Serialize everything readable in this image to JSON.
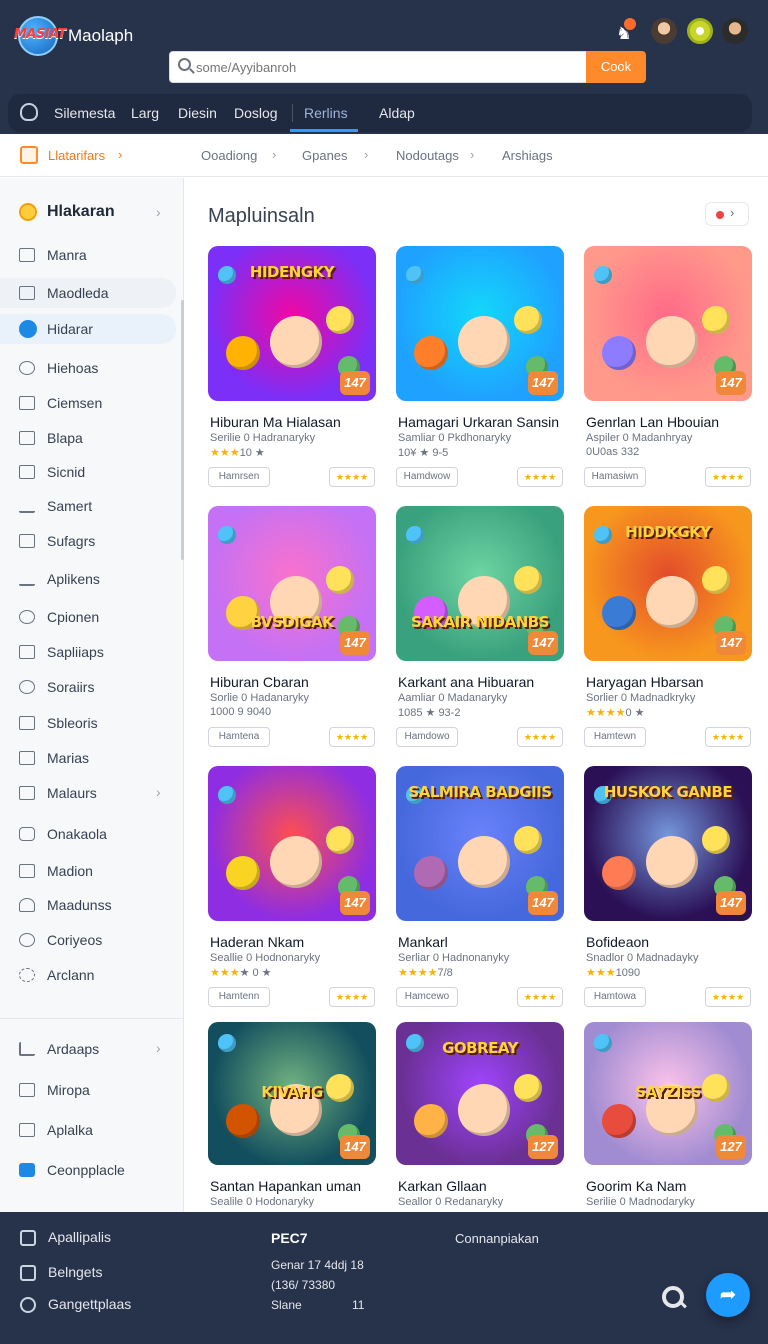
{
  "header": {
    "logo_text": "MASIAT",
    "app_title": "Maolaph",
    "search_placeholder": "some/Ayyibanroh",
    "search_button": "Cook"
  },
  "nav": {
    "items": [
      "Silemesta",
      "Larg",
      "Diesin",
      "Doslog",
      "Rerlins",
      "Aldap"
    ],
    "active_index": 4
  },
  "breadcrumb": {
    "items": [
      "Llatarifars",
      "Ooadiong",
      "Gpanes",
      "Nodoutags",
      "Arshiags"
    ]
  },
  "sidebar": {
    "header": "Hlakaran",
    "items": [
      "Manra",
      "Maodleda",
      "Hidarar",
      "Hiehoas",
      "Ciemsen",
      "Blapa",
      "Sicnid",
      "Samert",
      "Sufagrs",
      "Aplikens",
      "Cpionen",
      "Sapliiaps",
      "Soraiirs",
      "Sbleoris",
      "Marias",
      "Malaurs",
      "Onakaola",
      "Madion",
      "Maadunss",
      "Coriyeos",
      "Arclann"
    ],
    "bottom_items": [
      "Ardaaps",
      "Miropa",
      "Aplalka",
      "Ceonpplacle"
    ]
  },
  "main": {
    "section_title": "Mapluinsaln",
    "games": [
      {
        "thumb_title": "HIDENGKY",
        "title": "Hiburan Ma Hialasan",
        "sub": "Serilie 0 Hadranaryky",
        "stars": "★★★",
        "rating": "10 ★",
        "tag": "Hamrsen",
        "badge": "147"
      },
      {
        "thumb_title": "",
        "title": "Hamagari Urkaran Sansin",
        "sub": "Samliar 0 Pkdhonaryky",
        "stars": "",
        "rating": "10¥ ★ 9-5",
        "tag": "Hamdwow",
        "badge": "147"
      },
      {
        "thumb_title": "",
        "title": "Genrlan Lan Hbouian",
        "sub": "Aspiler 0 Madanhryay",
        "stars": "",
        "rating": "0U0as 332",
        "tag": "Hamasiwn",
        "badge": "147"
      },
      {
        "thumb_title": "BVSDIGAK",
        "title": "Hiburan Cbaran",
        "sub": "Sorlie 0 Hadanaryky",
        "stars": "",
        "rating": "1000 9 9040",
        "tag": "Hamtena",
        "badge": "147"
      },
      {
        "thumb_title": "SAKAIR NIDANBS",
        "title": "Karkant ana Hibuaran",
        "sub": "Aamliar 0 Madanaryky",
        "stars": "",
        "rating": "1085 ★ 93-2",
        "tag": "Hamdowo",
        "badge": "147"
      },
      {
        "thumb_title": "HIDDKGKY",
        "title": "Haryagan Hbarsan",
        "sub": "Sorlier 0 Madnadkryky",
        "stars": "★★★★",
        "rating": "0 ★",
        "tag": "Hamtewn",
        "badge": "147"
      },
      {
        "thumb_title": "",
        "title": "Haderan Nkam",
        "sub": "Seallie 0 Hodnonaryky",
        "stars": "★★★",
        "rating": "★ 0 ★",
        "tag": "Hamtenn",
        "badge": "147"
      },
      {
        "thumb_title": "SALMIRA BADGIIS",
        "title": "Mankarl",
        "sub": "Serliar 0 Hadnonanyky",
        "stars": "★★★★",
        "rating": "7/8",
        "tag": "Hamcewo",
        "badge": "147"
      },
      {
        "thumb_title": "HUSKOK GANBE",
        "title": "Bofideaon",
        "sub": "Snadlor 0 Madnadayky",
        "stars": "★★★",
        "rating": "1090",
        "tag": "Hamtowa",
        "badge": "147"
      },
      {
        "thumb_title": "KIVAHG",
        "title": "Santan Hapankan uman",
        "sub": "Sealile 0 Hodonaryky",
        "stars": "",
        "rating": "",
        "tag": "",
        "badge": "147"
      },
      {
        "thumb_title": "GOBREAY",
        "title": "Karkan Gllaan",
        "sub": "Seallor 0 Redanaryky",
        "stars": "",
        "rating": "",
        "tag": "",
        "badge": "127"
      },
      {
        "thumb_title": "SAYZISS",
        "title": "Goorim Ka Nam",
        "sub": "Serilie 0 Madnodaryky",
        "stars": "",
        "rating": "",
        "tag": "",
        "badge": "127"
      }
    ]
  },
  "footer": {
    "items": [
      "Apallipalis",
      "Belngets",
      "Gangettplaas"
    ],
    "col_head": "PEC7",
    "lines": [
      "Genar 17 4ddj 18",
      "(136/ 73380",
      "Slane"
    ],
    "slane_value": "11",
    "col2": "Connanpiakan"
  },
  "colors": {
    "header_bg": "#27324b",
    "accent_orange": "#ff8a2b",
    "accent_blue": "#1e9bff"
  }
}
